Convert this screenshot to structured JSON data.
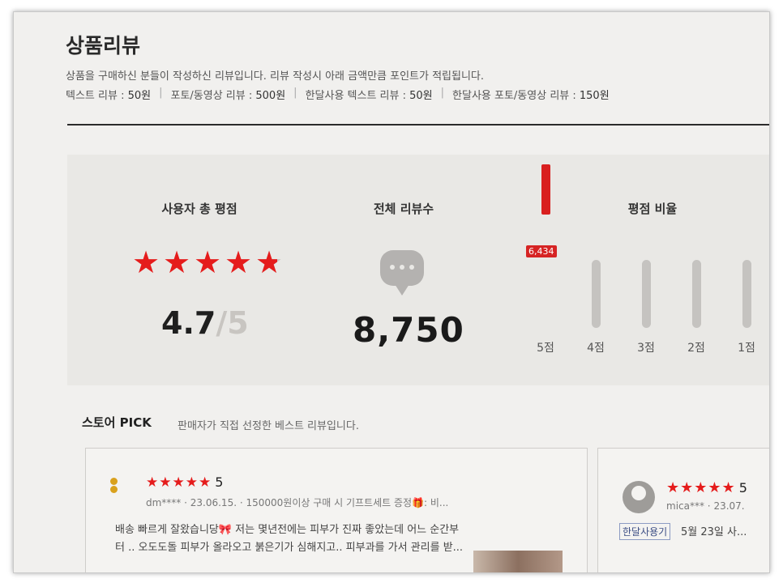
{
  "header": {
    "title": "상품리뷰",
    "intro": "상품을 구매하신 분들이 작성하신 리뷰입니다. 리뷰 작성시 아래 금액만큼 포인트가 적립됩니다.",
    "points": [
      {
        "label": "텍스트 리뷰 :",
        "amount": "50원"
      },
      {
        "label": "포토/동영상 리뷰 :",
        "amount": "500원"
      },
      {
        "label": "한달사용 텍스트 리뷰 :",
        "amount": "50원"
      },
      {
        "label": "한달사용 포토/동영상 리뷰 :",
        "amount": "150원"
      }
    ]
  },
  "summary": {
    "rating_title": "사용자 총 평점",
    "rating_value": "4.7",
    "rating_max": "/5",
    "rating_stars": 4.7,
    "count_title": "전체 리뷰수",
    "count_value": "8,750",
    "ratio_title": "평점 비율",
    "ratio": [
      {
        "label": "5점",
        "count": 6434,
        "badge": "6,434",
        "fraction": 0.74
      },
      {
        "label": "4점",
        "count": null,
        "badge": "",
        "fraction": 0
      },
      {
        "label": "3점",
        "count": null,
        "badge": "",
        "fraction": 0
      },
      {
        "label": "2점",
        "count": null,
        "badge": "",
        "fraction": 0
      },
      {
        "label": "1점",
        "count": null,
        "badge": "",
        "fraction": 0
      }
    ],
    "colors": {
      "accent": "#e51c1c",
      "track": "#c5c3c0"
    }
  },
  "pick": {
    "title": "스토어 PICK",
    "subtitle": "판매자가 직접 선정한 베스트 리뷰입니다.",
    "reviews": [
      {
        "stars": "★★★★★",
        "score": "5",
        "user": "dm****",
        "date": "23.06.15.",
        "option": "150000원이상 구매 시 기프트세트 증정🎁: 비...",
        "text": "배송 빠르게 잘왔습니당🎀 저는 몇년전에는 피부가 진짜 좋았는데 어느 순간부터 .. 오도도돌 피부가 올라오고 붉은기가 심해지고.. 피부과를 가서 관리를 받..."
      },
      {
        "stars": "★★★★★",
        "score": "5",
        "user": "mica***",
        "date": "23.07.",
        "tag": "한달사용기",
        "text": "5월 23일 사..."
      }
    ]
  }
}
